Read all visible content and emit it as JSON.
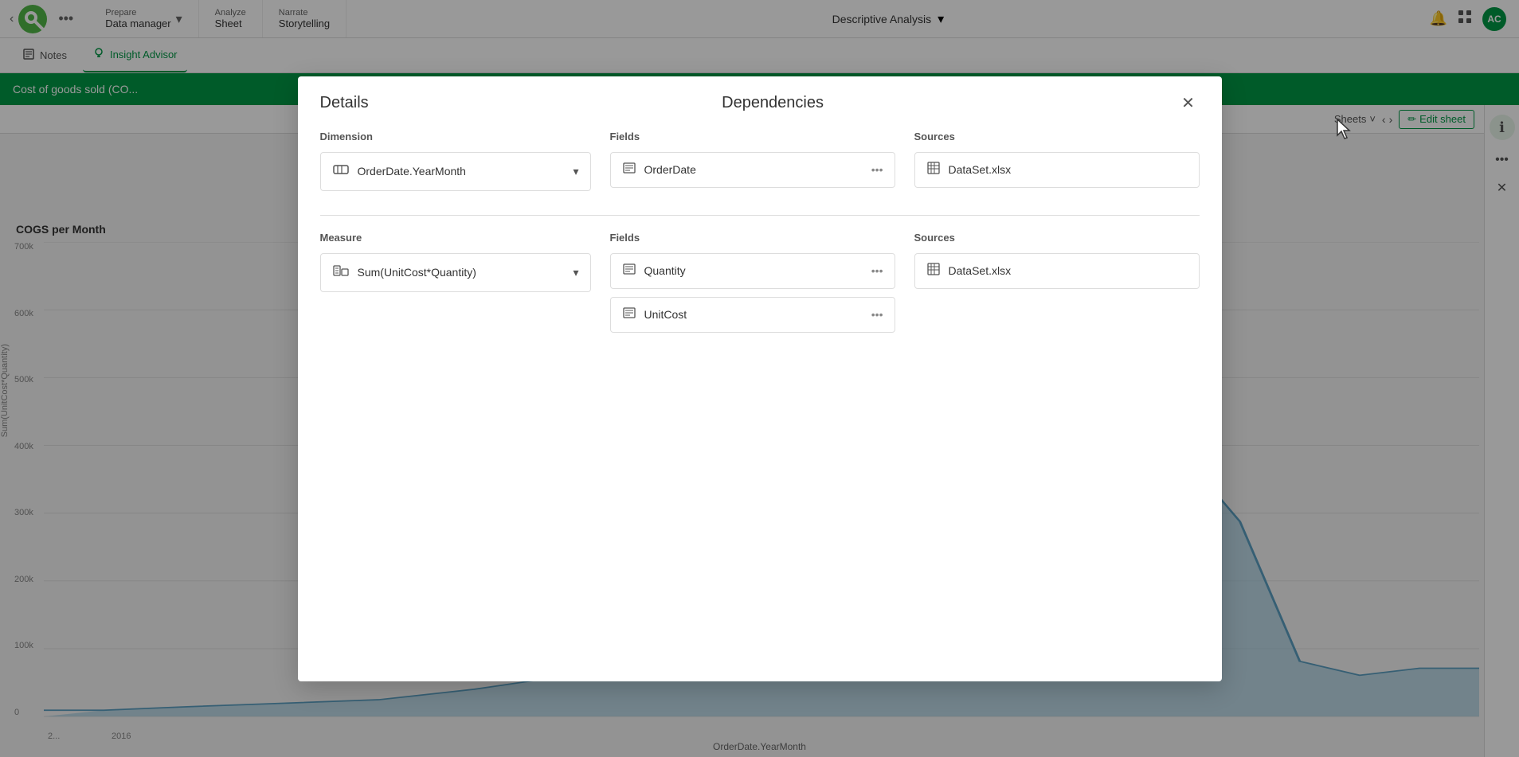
{
  "nav": {
    "back_icon": "‹",
    "dots_icon": "•••",
    "prepare_label": "Prepare",
    "prepare_subtitle": "Data manager",
    "analyze_label": "Analyze",
    "analyze_subtitle": "Sheet",
    "narrate_label": "Narrate",
    "narrate_subtitle": "Storytelling",
    "center_title": "Descriptive Analysis",
    "center_arrow": "▾",
    "bell_icon": "🔔",
    "grid_icon": "⊞",
    "avatar_label": "AC"
  },
  "second_nav": {
    "notes_icon": "📄",
    "notes_label": "Notes",
    "insight_icon": "💡",
    "insight_label": "Insight Advisor"
  },
  "green_header": {
    "title": "Cost of goods sold (CO..."
  },
  "chart": {
    "title": "COGS per Month",
    "y_labels": [
      "700k",
      "600k",
      "500k",
      "400k",
      "300k",
      "200k",
      "100k",
      "0"
    ],
    "x_label": "OrderDate.YearMonth",
    "axis_label": "Sum(UnitCost*Quantity)",
    "x_ticks": [
      "2...",
      "2016"
    ]
  },
  "sheet_toolbar": {
    "sheets_label": "Sheets",
    "sheets_arrow": "˅",
    "prev_arrow": "‹",
    "next_arrow": "›",
    "edit_icon": "✏",
    "edit_label": "Edit sheet"
  },
  "right_panel": {
    "info_icon": "ℹ",
    "dots_icon": "•••",
    "close_icon": "✕"
  },
  "modal": {
    "title_details": "Details",
    "title_dependencies": "Dependencies",
    "close_icon": "✕",
    "dimension_section": {
      "col_detail_label": "Dimension",
      "col_fields_label": "Fields",
      "col_sources_label": "Sources",
      "dimension_icon": "⬡",
      "dimension_value": "OrderDate.YearMonth",
      "dimension_arrow": "▾",
      "field_icon": "≡",
      "field_value": "OrderDate",
      "field_dots": "•••",
      "source_icon": "▦",
      "source_value": "DataSet.xlsx"
    },
    "measure_section": {
      "col_detail_label": "Measure",
      "col_fields_label": "Fields",
      "col_sources_label": "Sources",
      "measure_icon": "⊞",
      "measure_value": "Sum(UnitCost*Quantity)",
      "measure_arrow": "▾",
      "fields": [
        {
          "icon": "≡",
          "value": "Quantity",
          "dots": "•••"
        },
        {
          "icon": "≡",
          "value": "UnitCost",
          "dots": "•••"
        }
      ],
      "source_icon": "▦",
      "source_value": "DataSet.xlsx"
    }
  }
}
